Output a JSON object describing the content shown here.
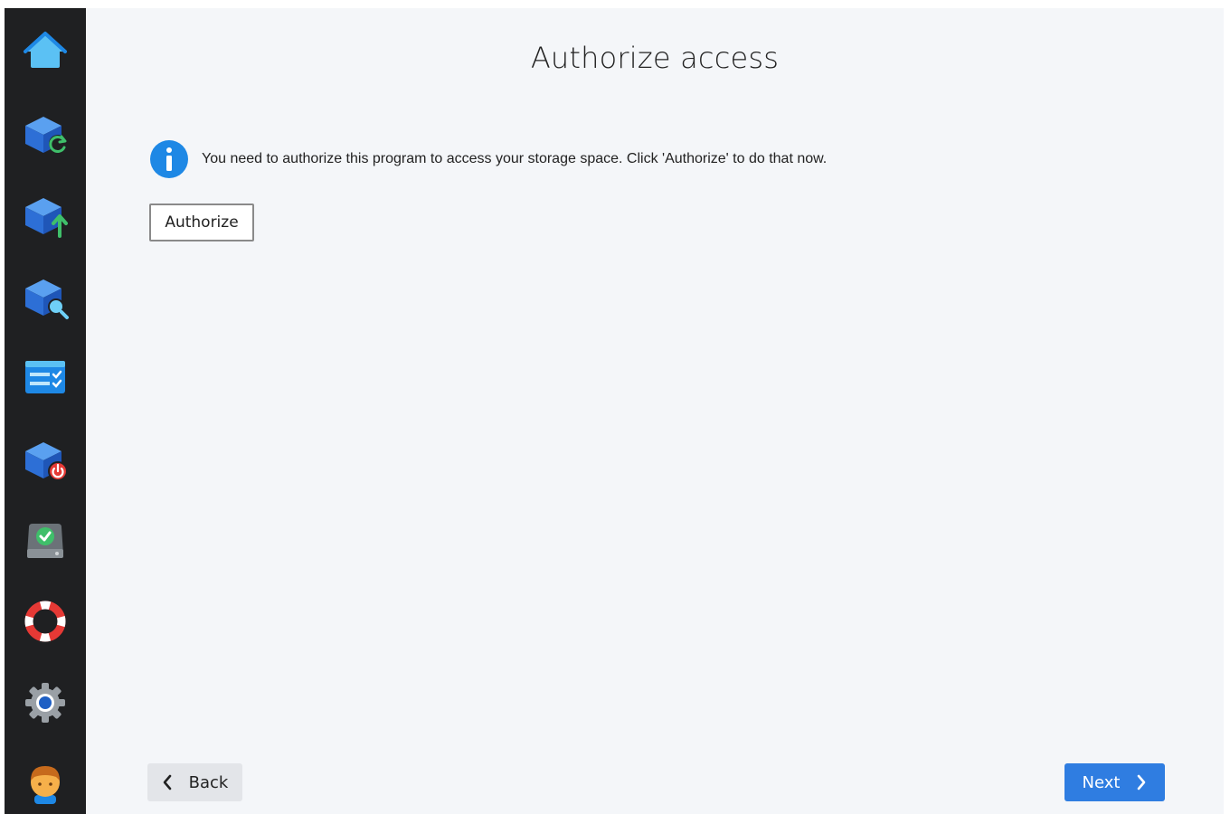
{
  "sidebar": {
    "items": [
      {
        "icon": "home-icon"
      },
      {
        "icon": "backup-sync-icon"
      },
      {
        "icon": "backup-upload-icon"
      },
      {
        "icon": "backup-search-icon"
      },
      {
        "icon": "task-list-icon"
      },
      {
        "icon": "backup-power-icon"
      },
      {
        "icon": "drive-check-icon"
      },
      {
        "icon": "lifebuoy-icon"
      },
      {
        "icon": "settings-gear-icon"
      },
      {
        "icon": "user-avatar-icon"
      }
    ]
  },
  "header": {
    "title": "Authorize access"
  },
  "main": {
    "info_icon": "info-icon",
    "info_message": "You need to authorize this program to access your storage space. Click 'Authorize' to do that now.",
    "authorize_label": "Authorize"
  },
  "footer": {
    "back_label": "Back",
    "next_label": "Next"
  },
  "colors": {
    "sidebar_bg": "#1f2022",
    "content_bg": "#f4f6f9",
    "accent": "#2f7de1",
    "info_blue": "#1e88e5"
  }
}
